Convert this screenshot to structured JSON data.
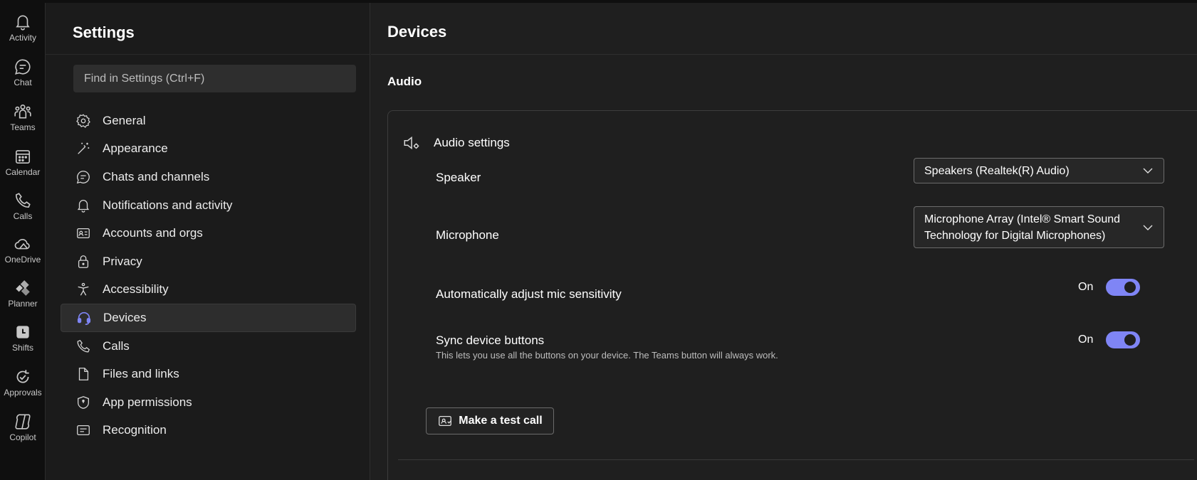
{
  "rail": {
    "items": [
      {
        "label": "Activity",
        "icon": "bell-icon"
      },
      {
        "label": "Chat",
        "icon": "chat-icon"
      },
      {
        "label": "Teams",
        "icon": "teams-icon"
      },
      {
        "label": "Calendar",
        "icon": "calendar-icon"
      },
      {
        "label": "Calls",
        "icon": "phone-icon"
      },
      {
        "label": "OneDrive",
        "icon": "cloud-icon"
      },
      {
        "label": "Planner",
        "icon": "planner-icon"
      },
      {
        "label": "Shifts",
        "icon": "clock-icon"
      },
      {
        "label": "Approvals",
        "icon": "approvals-icon"
      },
      {
        "label": "Copilot",
        "icon": "copilot-icon"
      }
    ]
  },
  "settings": {
    "title": "Settings",
    "search_placeholder": "Find in Settings (Ctrl+F)",
    "nav": [
      {
        "label": "General",
        "icon": "gear-icon"
      },
      {
        "label": "Appearance",
        "icon": "magic-wand-icon"
      },
      {
        "label": "Chats and channels",
        "icon": "chat-icon"
      },
      {
        "label": "Notifications and activity",
        "icon": "bell-icon"
      },
      {
        "label": "Accounts and orgs",
        "icon": "contact-card-icon"
      },
      {
        "label": "Privacy",
        "icon": "lock-icon"
      },
      {
        "label": "Accessibility",
        "icon": "accessibility-icon"
      },
      {
        "label": "Devices",
        "icon": "headset-icon",
        "active": true
      },
      {
        "label": "Calls",
        "icon": "phone-icon"
      },
      {
        "label": "Files and links",
        "icon": "document-icon"
      },
      {
        "label": "App permissions",
        "icon": "shield-icon"
      },
      {
        "label": "Recognition",
        "icon": "recognition-icon"
      }
    ]
  },
  "content": {
    "title": "Devices",
    "section": "Audio",
    "card": {
      "heading": "Audio settings",
      "speaker_label": "Speaker",
      "speaker_value": "Speakers (Realtek(R) Audio)",
      "microphone_label": "Microphone",
      "microphone_value": "Microphone Array (Intel® Smart Sound Technology for Digital Microphones)",
      "auto_adjust_label": "Automatically adjust mic sensitivity",
      "auto_adjust_state": "On",
      "sync_label": "Sync device buttons",
      "sync_description": "This lets you use all the buttons on your device. The Teams button will always work.",
      "sync_state": "On",
      "test_call_label": "Make a test call"
    }
  },
  "colors": {
    "accent": "#7f85f5",
    "background": "#1f1f1f",
    "rail": "#0f0f0f"
  }
}
